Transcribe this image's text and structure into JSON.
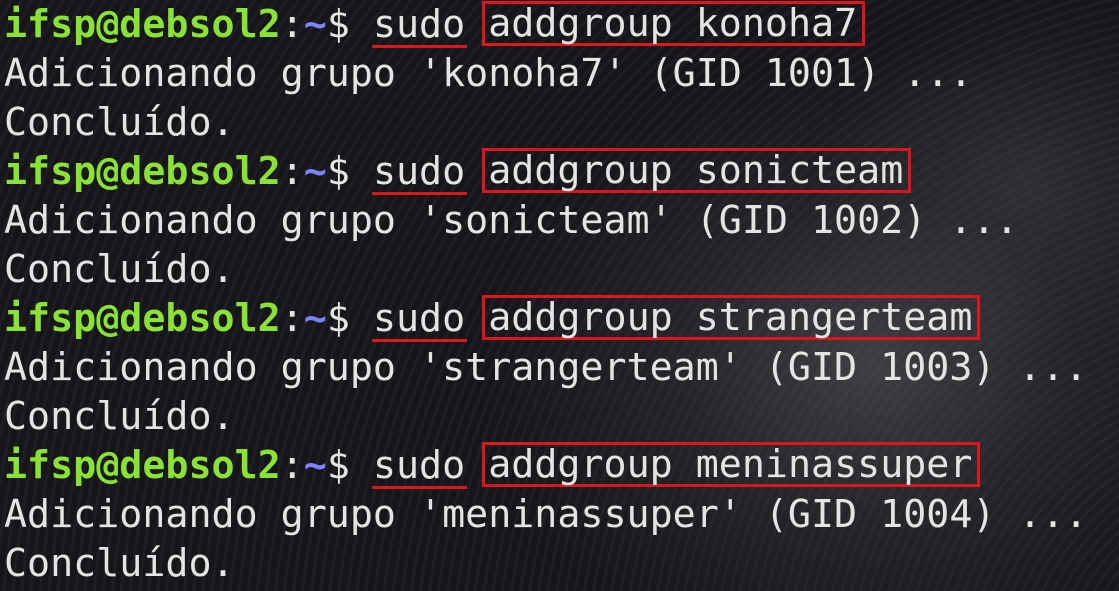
{
  "prompt": {
    "user_host": "ifsp@debsol2",
    "colon": ":",
    "path": "~",
    "symbol": "$ "
  },
  "entries": [
    {
      "sudo": "sudo",
      "command": "addgroup konoha7",
      "output": "Adicionando grupo 'konoha7' (GID 1001) ...",
      "status": "Concluído."
    },
    {
      "sudo": "sudo",
      "command": "addgroup sonicteam",
      "output": "Adicionando grupo 'sonicteam' (GID 1002) ...",
      "status": "Concluído."
    },
    {
      "sudo": "sudo",
      "command": "addgroup strangerteam",
      "output": "Adicionando grupo 'strangerteam' (GID 1003) ...",
      "status": "Concluído."
    },
    {
      "sudo": "sudo",
      "command": "addgroup meninassuper",
      "output": "Adicionando grupo 'meninassuper' (GID 1004) ...",
      "status": "Concluído."
    }
  ],
  "colors": {
    "user_host": "#8ae234",
    "path": "#7b85ff",
    "text": "#e4e4e4",
    "highlight": "#e0141c",
    "background": "#16161a"
  }
}
